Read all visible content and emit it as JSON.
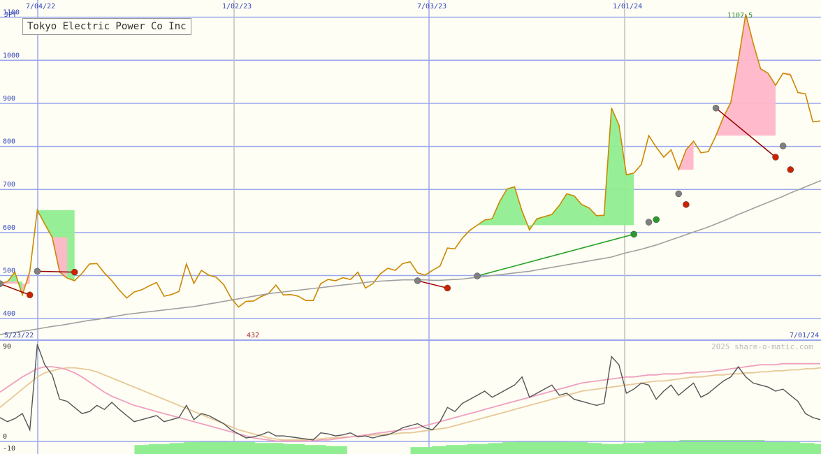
{
  "chart_data": [
    {
      "type": "line",
      "title": "Tokyo Electric Power Co Inc",
      "ylabel": "JPY",
      "ylim": [
        350,
        1140
      ],
      "y_ticks": [
        400,
        500,
        600,
        700,
        800,
        900,
        1000,
        1100
      ],
      "x_ticks": [
        "7/04/22",
        "1/02/23",
        "7/03/23",
        "1/01/24"
      ],
      "start_label": "5/23/22",
      "end_label": "7/01/24",
      "min_label": "432",
      "max_label": "1107.5",
      "grid": true,
      "series": [
        {
          "color": "#cc8800",
          "values": [
            481,
            486,
            508,
            455,
            510,
            652,
            620,
            589,
            508,
            494,
            488,
            505,
            527,
            528,
            506,
            488,
            466,
            448,
            462,
            467,
            476,
            484,
            452,
            456,
            463,
            527,
            482,
            512,
            501,
            496,
            479,
            447,
            427,
            440,
            441,
            451,
            458,
            478,
            455,
            456,
            452,
            442,
            442,
            481,
            491,
            488,
            495,
            491,
            508,
            471,
            481,
            504,
            517,
            512,
            528,
            532,
            506,
            501,
            512,
            522,
            564,
            562,
            587,
            605,
            617,
            629,
            632,
            672,
            701,
            706,
            650,
            606,
            632,
            637,
            642,
            663,
            690,
            685,
            665,
            657,
            639,
            640,
            889,
            850,
            734,
            738,
            758,
            825,
            798,
            775,
            792,
            746,
            792,
            812,
            785,
            788,
            825,
            868,
            902,
            1000,
            1107,
            1040,
            980,
            970,
            942,
            970,
            966,
            925,
            922,
            857,
            859
          ]
        },
        {
          "color": "#a0a0a0",
          "values": [
            363,
            366,
            368,
            371,
            373,
            376,
            379,
            382,
            384,
            387,
            390,
            393,
            396,
            398,
            401,
            404,
            407,
            410,
            412,
            414,
            416,
            418,
            420,
            422,
            424,
            426,
            428,
            431,
            434,
            437,
            440,
            443,
            446,
            449,
            452,
            455,
            458,
            460,
            462,
            464,
            466,
            468,
            470,
            472,
            474,
            476,
            478,
            480,
            482,
            484,
            486,
            487,
            488,
            489,
            490,
            490,
            490,
            490,
            489,
            489,
            490,
            491,
            492,
            494,
            496,
            498,
            500,
            502,
            504,
            506,
            508,
            510,
            513,
            516,
            519,
            522,
            525,
            528,
            531,
            534,
            537,
            540,
            543,
            548,
            553,
            557,
            561,
            566,
            571,
            577,
            583,
            589,
            595,
            601,
            607,
            613,
            620,
            627,
            634,
            642,
            649,
            656,
            663,
            670,
            677,
            684,
            692,
            699,
            706,
            713,
            720,
            727,
            734,
            741,
            749,
            756
          ]
        }
      ],
      "markers": [
        {
          "color": "#808080",
          "x": 0,
          "y": 481
        },
        {
          "color": "#cc2200",
          "x": 4,
          "y": 455
        },
        {
          "color": "#808080",
          "x": 5,
          "y": 510
        },
        {
          "color": "#cc2200",
          "x": 10,
          "y": 508
        },
        {
          "color": "#808080",
          "x": 56,
          "y": 488
        },
        {
          "color": "#cc2200",
          "x": 60,
          "y": 471
        },
        {
          "color": "#808080",
          "x": 64,
          "y": 499
        },
        {
          "color": "#2a9a2a",
          "x": 85,
          "y": 596
        },
        {
          "color": "#808080",
          "x": 87,
          "y": 624
        },
        {
          "color": "#2a9a2a",
          "x": 88,
          "y": 630
        },
        {
          "color": "#808080",
          "x": 91,
          "y": 690
        },
        {
          "color": "#cc2200",
          "x": 92,
          "y": 665
        },
        {
          "color": "#808080",
          "x": 96,
          "y": 889
        },
        {
          "color": "#cc2200",
          "x": 104,
          "y": 775
        },
        {
          "color": "#808080",
          "x": 105,
          "y": 801
        },
        {
          "color": "#cc2200",
          "x": 106,
          "y": 746
        },
        {
          "color": "#808080",
          "x": 117,
          "y": 1107
        },
        {
          "color": "#cc2200",
          "x": 122,
          "y": 942
        }
      ]
    },
    {
      "type": "line",
      "ylim": [
        -10,
        100
      ],
      "y_ticks": [
        90,
        0,
        -10
      ],
      "watermark": "2025 share-o-matic.com",
      "series": [
        {
          "color": "#555555",
          "values": [
            20,
            16,
            19,
            24,
            8,
            92,
            72,
            62,
            38,
            36,
            30,
            24,
            26,
            32,
            28,
            35,
            28,
            22,
            16,
            18,
            20,
            22,
            16,
            18,
            20,
            32,
            18,
            24,
            22,
            18,
            14,
            8,
            4,
            0,
            1,
            3,
            6,
            2,
            2,
            1,
            0,
            -1,
            -2,
            5,
            4,
            2,
            3,
            5,
            1,
            2,
            0,
            2,
            3,
            6,
            10,
            12,
            14,
            10,
            8,
            16,
            30,
            26,
            34,
            38,
            42,
            46,
            40,
            44,
            48,
            52,
            60,
            40,
            44,
            48,
            52,
            42,
            44,
            38,
            36,
            34,
            32,
            34,
            80,
            72,
            44,
            48,
            54,
            52,
            38,
            46,
            52,
            42,
            48,
            54,
            40,
            44,
            50,
            56,
            60,
            70,
            60,
            54,
            52,
            50,
            46,
            48,
            42,
            36,
            24,
            20,
            18
          ],
          "name": ""
        },
        {
          "color": "#f0a0c0",
          "values": [
            45,
            50,
            55,
            60,
            64,
            68,
            70,
            70,
            69,
            67,
            64,
            60,
            55,
            50,
            45,
            41,
            38,
            35,
            32,
            30,
            28,
            26,
            24,
            22,
            20,
            18,
            16,
            14,
            12,
            10,
            8,
            6,
            4,
            2,
            0,
            -1,
            -2,
            -3,
            -3,
            -3,
            -3,
            -3,
            -3,
            -2,
            -2,
            -1,
            0,
            1,
            2,
            3,
            4,
            5,
            6,
            7,
            8,
            9,
            10,
            12,
            14,
            16,
            18,
            20,
            22,
            24,
            26,
            28,
            30,
            32,
            34,
            36,
            38,
            40,
            42,
            44,
            46,
            48,
            50,
            52,
            54,
            55,
            56,
            57,
            58,
            59,
            60,
            60,
            61,
            62,
            62,
            63,
            63,
            63,
            64,
            64,
            65,
            65,
            66,
            67,
            68,
            69,
            70,
            71,
            72,
            72,
            72,
            73,
            73,
            73,
            73,
            73,
            73
          ]
        },
        {
          "color": "#e8c898",
          "values": [
            30,
            36,
            42,
            48,
            54,
            60,
            64,
            66,
            68,
            69,
            69,
            68,
            67,
            65,
            62,
            59,
            56,
            53,
            50,
            47,
            44,
            41,
            38,
            35,
            32,
            29,
            26,
            23,
            20,
            17,
            14,
            11,
            8,
            6,
            4,
            2,
            0,
            -1,
            -2,
            -2,
            -2,
            -2,
            -1,
            -1,
            0,
            0,
            1,
            1,
            2,
            2,
            3,
            3,
            4,
            4,
            5,
            5,
            6,
            7,
            8,
            9,
            10,
            12,
            14,
            16,
            18,
            20,
            22,
            24,
            26,
            28,
            30,
            32,
            34,
            36,
            38,
            40,
            42,
            44,
            46,
            47,
            48,
            49,
            50,
            51,
            52,
            53,
            54,
            55,
            56,
            56,
            57,
            58,
            59,
            60,
            60,
            61,
            62,
            62,
            63,
            63,
            64,
            64,
            65,
            65,
            66,
            66,
            67,
            67,
            68,
            68,
            69,
            69
          ]
        }
      ],
      "bars": [
        0,
        0,
        0,
        0,
        0,
        0,
        0,
        0,
        0,
        0,
        0,
        0,
        0,
        0,
        0,
        0,
        0,
        0,
        0,
        3,
        3,
        4,
        4,
        4,
        5,
        5,
        6,
        6,
        7,
        7,
        7,
        7,
        6,
        6,
        6,
        6,
        5,
        5,
        5,
        5,
        4,
        4,
        4,
        3,
        3,
        3,
        2,
        2,
        2,
        0,
        0,
        0,
        0,
        0,
        0,
        0,
        0,
        0,
        1,
        1,
        1,
        2,
        2,
        3,
        3,
        3,
        4,
        4,
        4,
        5,
        5,
        6,
        6,
        7,
        7,
        7,
        7,
        7,
        7,
        7,
        6,
        6,
        6,
        5,
        5,
        4,
        4,
        4,
        5,
        5,
        5,
        6,
        6,
        7,
        7,
        7,
        8,
        8,
        8,
        8,
        8,
        8,
        8,
        8,
        8,
        8,
        8,
        8,
        7,
        7,
        7,
        6,
        6,
        5,
        5,
        4
      ],
      "bar_color": "#90ee90"
    }
  ]
}
